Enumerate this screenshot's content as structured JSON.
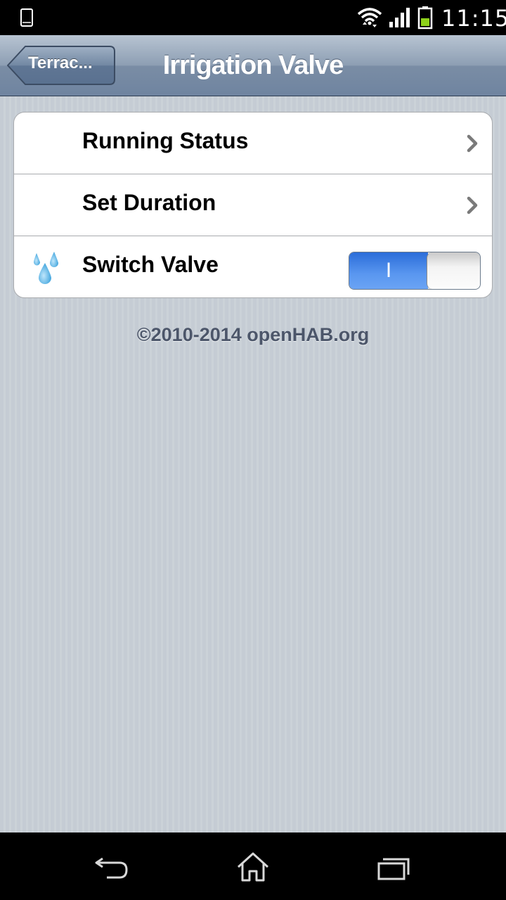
{
  "status_bar": {
    "time": "11:15",
    "icons": [
      "phone-icon",
      "wifi-icon",
      "signal-icon",
      "battery-icon"
    ]
  },
  "nav": {
    "back_label": "Terrac...",
    "title": "Irrigation Valve"
  },
  "rows": [
    {
      "label": "Running Status",
      "accessory": "chevron-right-icon"
    },
    {
      "label": "Set Duration",
      "accessory": "chevron-right-icon"
    },
    {
      "label": "Switch Valve",
      "icon": "water-drops-icon",
      "toggle_label": "I",
      "toggle_state": "on"
    }
  ],
  "footer": "©2010-2014 openHAB.org",
  "colors": {
    "nav_bar": "#7f92aa",
    "toggle_on": "#4a8ae8",
    "background": "#c5ccd4"
  },
  "android_nav": [
    "back-icon",
    "home-icon",
    "recent-apps-icon"
  ]
}
